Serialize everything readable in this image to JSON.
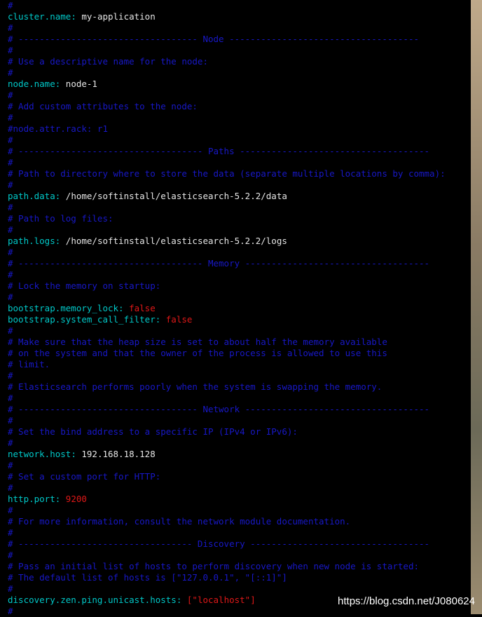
{
  "lines": [
    {
      "t": "comment",
      "text": "#"
    },
    {
      "t": "kv",
      "key": "cluster.name",
      "value": "my-application"
    },
    {
      "t": "comment",
      "text": "#"
    },
    {
      "t": "comment",
      "text": "# ---------------------------------- Node ------------------------------------"
    },
    {
      "t": "comment",
      "text": "#"
    },
    {
      "t": "comment",
      "text": "# Use a descriptive name for the node:"
    },
    {
      "t": "comment",
      "text": "#"
    },
    {
      "t": "kv",
      "key": "node.name",
      "value": "node-1"
    },
    {
      "t": "comment",
      "text": "#"
    },
    {
      "t": "comment",
      "text": "# Add custom attributes to the node:"
    },
    {
      "t": "comment",
      "text": "#"
    },
    {
      "t": "comment",
      "text": "#node.attr.rack: r1"
    },
    {
      "t": "comment",
      "text": "#"
    },
    {
      "t": "comment",
      "text": "# ----------------------------------- Paths ------------------------------------"
    },
    {
      "t": "comment",
      "text": "#"
    },
    {
      "t": "comment",
      "text": "# Path to directory where to store the data (separate multiple locations by comma):"
    },
    {
      "t": "comment",
      "text": "#"
    },
    {
      "t": "kv",
      "key": "path.data",
      "value": "/home/softinstall/elasticsearch-5.2.2/data"
    },
    {
      "t": "comment",
      "text": "#"
    },
    {
      "t": "comment",
      "text": "# Path to log files:"
    },
    {
      "t": "comment",
      "text": "#"
    },
    {
      "t": "kv",
      "key": "path.logs",
      "value": "/home/softinstall/elasticsearch-5.2.2/logs"
    },
    {
      "t": "comment",
      "text": "#"
    },
    {
      "t": "comment",
      "text": "# ----------------------------------- Memory -----------------------------------"
    },
    {
      "t": "comment",
      "text": "#"
    },
    {
      "t": "comment",
      "text": "# Lock the memory on startup:"
    },
    {
      "t": "comment",
      "text": "#"
    },
    {
      "t": "kv",
      "key": "bootstrap.memory_lock",
      "value": "false",
      "red": true
    },
    {
      "t": "kv",
      "key": "bootstrap.system_call_filter",
      "value": "false",
      "red": true
    },
    {
      "t": "comment",
      "text": "#"
    },
    {
      "t": "comment",
      "text": "# Make sure that the heap size is set to about half the memory available"
    },
    {
      "t": "comment",
      "text": "# on the system and that the owner of the process is allowed to use this"
    },
    {
      "t": "comment",
      "text": "# limit."
    },
    {
      "t": "comment",
      "text": "#"
    },
    {
      "t": "comment",
      "text": "# Elasticsearch performs poorly when the system is swapping the memory."
    },
    {
      "t": "comment",
      "text": "#"
    },
    {
      "t": "comment",
      "text": "# ---------------------------------- Network -----------------------------------"
    },
    {
      "t": "comment",
      "text": "#"
    },
    {
      "t": "comment",
      "text": "# Set the bind address to a specific IP (IPv4 or IPv6):"
    },
    {
      "t": "comment",
      "text": "#"
    },
    {
      "t": "kv",
      "key": "network.host",
      "value": "192.168.18.128"
    },
    {
      "t": "comment",
      "text": "#"
    },
    {
      "t": "comment",
      "text": "# Set a custom port for HTTP:"
    },
    {
      "t": "comment",
      "text": "#"
    },
    {
      "t": "kv",
      "key": "http.port",
      "value": "9200",
      "red": true
    },
    {
      "t": "comment",
      "text": "#"
    },
    {
      "t": "comment",
      "text": "# For more information, consult the network module documentation."
    },
    {
      "t": "comment",
      "text": "#"
    },
    {
      "t": "comment",
      "text": "# --------------------------------- Discovery ----------------------------------"
    },
    {
      "t": "comment",
      "text": "#"
    },
    {
      "t": "comment",
      "text": "# Pass an initial list of hosts to perform discovery when new node is started:"
    },
    {
      "t": "comment",
      "text": "# The default list of hosts is [\"127.0.0.1\", \"[::1]\"]"
    },
    {
      "t": "comment",
      "text": "#"
    },
    {
      "t": "kv",
      "key": "discovery.zen.ping.unicast.hosts",
      "value": "[\"localhost\"]",
      "red": true
    },
    {
      "t": "comment",
      "text": "#"
    }
  ],
  "watermark": "https://blog.csdn.net/J080624",
  "colors": {
    "comment": "#1818c8",
    "key": "#00c8c8",
    "value": "#e6e6e6",
    "value_red": "#e01818",
    "background": "#000000"
  }
}
